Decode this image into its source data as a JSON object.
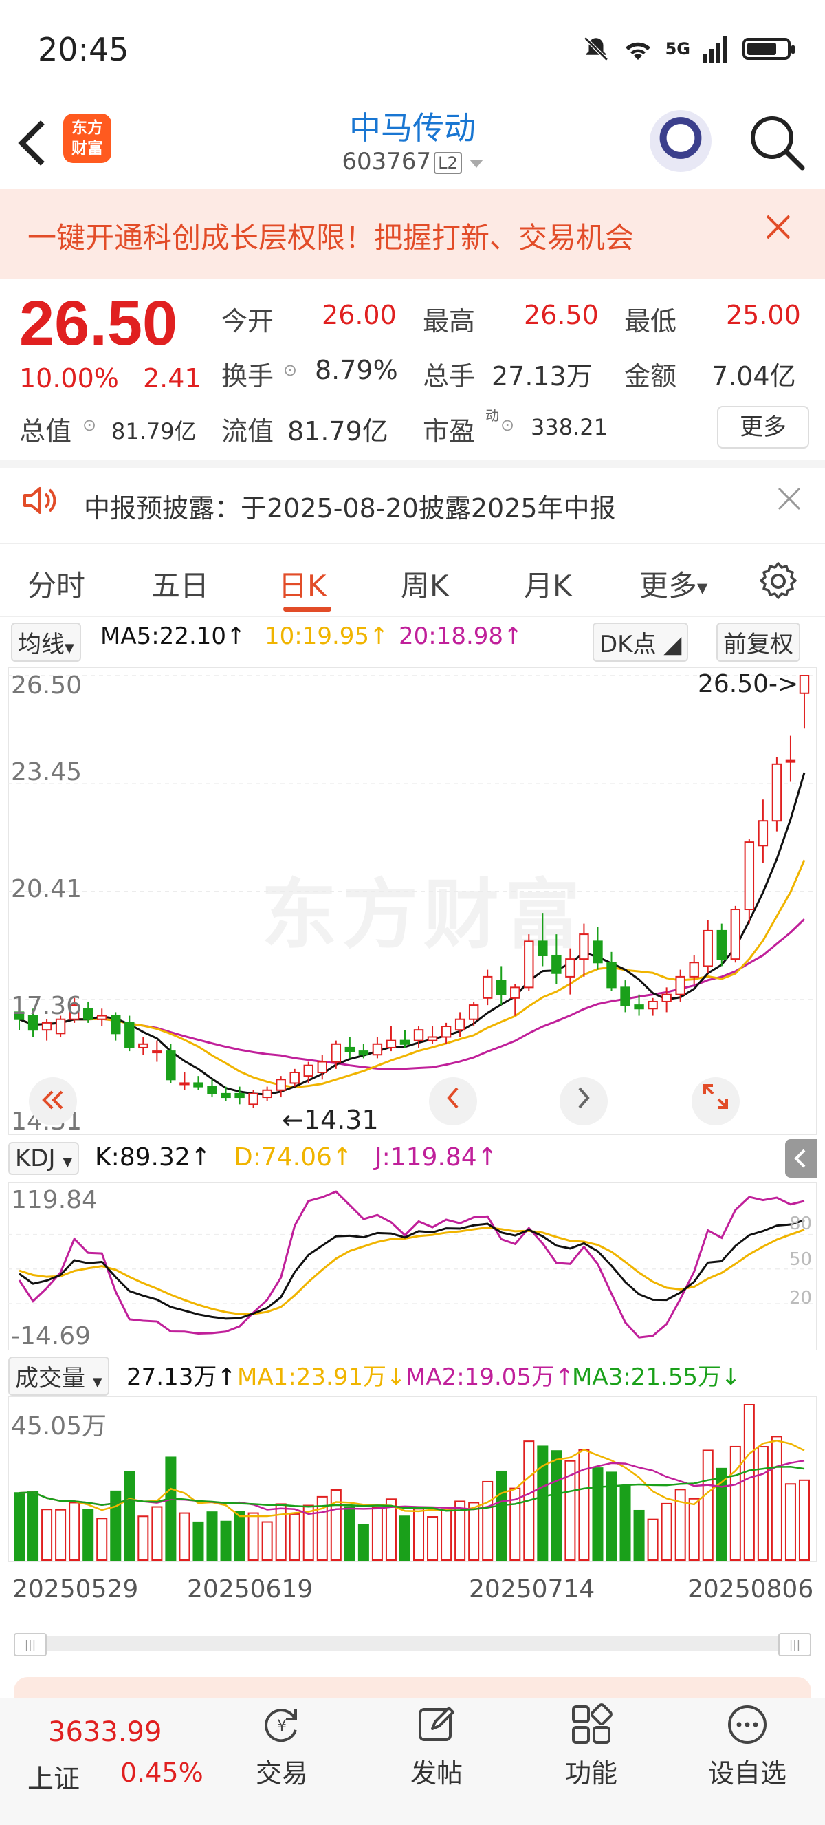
{
  "status_bar": {
    "time": "20:45",
    "network": "5G",
    "battery_level": 0.75
  },
  "header": {
    "logo_line1": "东方",
    "logo_line2": "财富",
    "stock_name": "中马传动",
    "stock_code": "603767",
    "level_badge": "L2"
  },
  "banner": {
    "text": "一键开通科创成长层权限！把握打新、交易机会"
  },
  "quote": {
    "price": "26.50",
    "change_pct": "10.00%",
    "change_amount": "2.41",
    "open_label": "今开",
    "open": "26.00",
    "high_label": "最高",
    "high": "26.50",
    "low_label": "最低",
    "low": "25.00",
    "turnover_label": "换手",
    "turnover": "8.79%",
    "volume_label": "总手",
    "volume": "27.13万",
    "amount_label": "金额",
    "amount": "7.04亿",
    "mktcap_label": "总值",
    "mktcap": "81.79亿",
    "float_label": "流值",
    "float_cap": "81.79亿",
    "pe_label": "市盈",
    "pe_sup": "动",
    "pe": "338.21",
    "more_label": "更多"
  },
  "notice": {
    "text": "中报预披露：于2025-08-20披露2025年中报"
  },
  "tabs": [
    {
      "label": "分时"
    },
    {
      "label": "五日"
    },
    {
      "label": "日K"
    },
    {
      "label": "周K"
    },
    {
      "label": "月K"
    },
    {
      "label": "更多"
    }
  ],
  "ma_legend": {
    "selector": "均线",
    "ma5": "MA5:22.10↑",
    "ma10": "10:19.95↑",
    "ma20": "20:18.98↑",
    "dk": "DK点",
    "adjust": "前复权"
  },
  "kline_axis": {
    "top": "26.50",
    "y2": "23.45",
    "y3": "20.41",
    "y4": "17.36",
    "bottom": "14.31",
    "last_price_tag": "26.50->",
    "min_tag": "14.31"
  },
  "watermark": "东方财富",
  "kdj": {
    "selector": "KDJ",
    "k": "K:89.32↑",
    "d": "D:74.06↑",
    "j": "J:119.84↑",
    "max": "119.84",
    "min": "-14.69",
    "lvl80": "80",
    "lvl50": "50",
    "lvl20": "20"
  },
  "volume": {
    "selector": "成交量",
    "value": "27.13万↑",
    "ma1": "MA1:23.91万↓",
    "ma2": "MA2:19.05万↑",
    "ma3": "MA3:21.55万↓",
    "max": "45.05万"
  },
  "dates": [
    "20250529",
    "20250619",
    "20250714",
    "20250806"
  ],
  "index": {
    "value": "3633.99",
    "name": "上证",
    "pct": "0.45%"
  },
  "bottom_nav": [
    {
      "label": "交易",
      "icon": "yen-exchange-icon"
    },
    {
      "label": "发帖",
      "icon": "edit-icon"
    },
    {
      "label": "功能",
      "icon": "grid-icon"
    },
    {
      "label": "设自选",
      "icon": "more-dots-icon"
    }
  ],
  "colors": {
    "up": "#e02020",
    "down": "#1aa01a",
    "ma5": "#111111",
    "ma10": "#f0b400",
    "ma20": "#c0209a",
    "accent": "#e24c28"
  },
  "chart_data": {
    "type": "candlestick",
    "price_axis_labels": [
      "26.50",
      "23.45",
      "20.41",
      "17.36",
      "14.31"
    ],
    "ohlc": [
      [
        17.0,
        17.3,
        16.5,
        16.8
      ],
      [
        16.9,
        17.1,
        16.3,
        16.5
      ],
      [
        16.5,
        16.8,
        16.2,
        16.7
      ],
      [
        16.4,
        16.9,
        16.3,
        16.8
      ],
      [
        16.8,
        17.4,
        16.7,
        17.2
      ],
      [
        17.1,
        17.3,
        16.7,
        16.8
      ],
      [
        16.8,
        17.1,
        16.6,
        16.9
      ],
      [
        16.9,
        17.0,
        16.2,
        16.4
      ],
      [
        16.7,
        16.9,
        15.9,
        16.0
      ],
      [
        16.0,
        16.3,
        15.8,
        16.1
      ],
      [
        15.9,
        16.2,
        15.6,
        15.9
      ],
      [
        15.9,
        16.1,
        15.0,
        15.1
      ],
      [
        15.0,
        15.3,
        14.8,
        15.0
      ],
      [
        15.0,
        15.2,
        14.8,
        14.9
      ],
      [
        14.9,
        15.1,
        14.6,
        14.7
      ],
      [
        14.7,
        14.9,
        14.5,
        14.6
      ],
      [
        14.7,
        14.9,
        14.4,
        14.6
      ],
      [
        14.4,
        14.8,
        14.31,
        14.7
      ],
      [
        14.6,
        14.9,
        14.5,
        14.8
      ],
      [
        14.8,
        15.2,
        14.6,
        15.1
      ],
      [
        15.0,
        15.4,
        14.9,
        15.3
      ],
      [
        15.2,
        15.6,
        15.0,
        15.5
      ],
      [
        15.3,
        15.8,
        15.1,
        15.6
      ],
      [
        15.6,
        16.2,
        15.4,
        16.1
      ],
      [
        16.0,
        16.3,
        15.7,
        15.9
      ],
      [
        15.9,
        16.1,
        15.7,
        15.8
      ],
      [
        15.8,
        16.3,
        15.7,
        16.1
      ],
      [
        16.0,
        16.6,
        15.9,
        16.2
      ],
      [
        16.2,
        16.5,
        16.0,
        16.1
      ],
      [
        16.2,
        16.6,
        16.0,
        16.5
      ],
      [
        16.2,
        16.6,
        16.1,
        16.3
      ],
      [
        16.3,
        16.7,
        16.1,
        16.6
      ],
      [
        16.5,
        17.0,
        16.3,
        16.8
      ],
      [
        16.8,
        17.3,
        16.6,
        17.2
      ],
      [
        17.4,
        18.2,
        17.2,
        18.0
      ],
      [
        17.9,
        18.3,
        17.2,
        17.5
      ],
      [
        17.4,
        17.8,
        16.9,
        17.7
      ],
      [
        17.7,
        19.2,
        17.6,
        19.0
      ],
      [
        19.0,
        19.8,
        18.3,
        18.6
      ],
      [
        18.6,
        19.2,
        17.8,
        18.1
      ],
      [
        18.0,
        18.8,
        17.5,
        18.5
      ],
      [
        18.5,
        19.5,
        18.0,
        19.2
      ],
      [
        19.0,
        19.4,
        18.2,
        18.4
      ],
      [
        18.4,
        18.7,
        17.6,
        17.7
      ],
      [
        17.7,
        17.9,
        17.0,
        17.2
      ],
      [
        17.2,
        17.5,
        16.9,
        17.1
      ],
      [
        17.1,
        17.4,
        16.9,
        17.3
      ],
      [
        17.3,
        17.7,
        17.0,
        17.5
      ],
      [
        17.5,
        18.2,
        17.3,
        18.0
      ],
      [
        18.0,
        18.6,
        17.8,
        18.4
      ],
      [
        18.3,
        19.6,
        18.1,
        19.3
      ],
      [
        19.3,
        19.5,
        18.3,
        18.5
      ],
      [
        18.5,
        20.0,
        18.4,
        19.9
      ],
      [
        19.9,
        21.9,
        19.5,
        21.8
      ],
      [
        21.7,
        23.0,
        21.2,
        22.4
      ],
      [
        22.4,
        24.2,
        22.1,
        24.0
      ],
      [
        24.1,
        24.8,
        23.5,
        24.1
      ],
      [
        26.0,
        26.5,
        25.0,
        26.5
      ]
    ],
    "kdj_range": [
      -14.69,
      119.84
    ],
    "volume_max": "45.05万"
  }
}
